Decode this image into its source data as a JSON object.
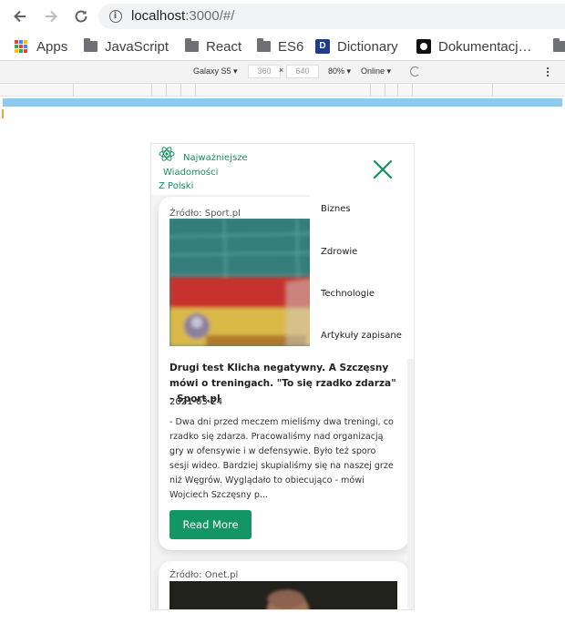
{
  "browser": {
    "url_host": "localhost",
    "url_rest": ":3000/#/",
    "bookmarks": [
      "Apps",
      "JavaScript",
      "React",
      "ES6",
      "Dictionary",
      "Dokumentacj…"
    ],
    "dict_icon_letter": "D"
  },
  "devtools": {
    "device": "Galaxy S5 ▾",
    "width": "360",
    "times": "×",
    "height": "640",
    "zoom": "80% ▾",
    "network": "Online ▾"
  },
  "app": {
    "brand": [
      "Najważniejsze",
      "Wiadomości",
      "Z Polski"
    ],
    "menu": [
      "Biznes",
      "Zdrowie",
      "Technologie",
      "Artykuły zapisane"
    ],
    "articles": [
      {
        "source": "Źródło: Sport.pl",
        "title": "Drugi test Klicha negatywny. A Szczęsny mówi o treningach. \"To się rzadko zdarza\" - Sport.pl",
        "date": "2021-03-24",
        "description": "- Dwa dni przed meczem mieliśmy dwa treningi, co rzadko się zdarza. Pracowaliśmy nad organizacją gry w ofensywie i w defensywie. Było też sporo sesji wideo. Bardziej skupialiśmy się na naszej grze niż Węgrów. Wyglądało to obiecująco - mówi Wojciech Szczęsny p...",
        "button": "Read More"
      },
      {
        "source": "Źródło: Onet.pl"
      }
    ]
  },
  "colors": {
    "brand": "#14915d",
    "button": "#139566",
    "devtools_media_bar": "#8ecaf0"
  }
}
